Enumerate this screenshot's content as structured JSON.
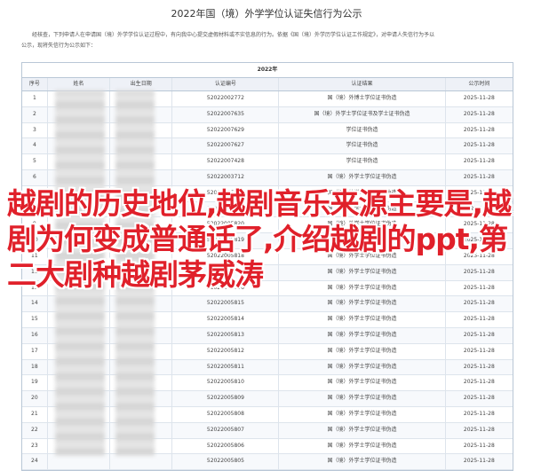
{
  "document": {
    "title": "2022年国（境）外学学位认证失信行为公示",
    "intro_line1": "经核查，下列申请人在申请国（境）外学学位认证过程中，有向我中心提交虚假材料或不实信息的行为。依据《国（境）外学历学位认证工作规定》，对申请人失信行为予以",
    "intro_line2": "公示，现将失信行为公示如下："
  },
  "table": {
    "caption": "2022年",
    "headers": [
      "序号",
      "姓名",
      "出生日期",
      "认证编号",
      "认证结果",
      "公示时间"
    ],
    "rows": [
      [
        "1",
        "",
        "",
        "52022002772",
        "国（境）外博士学位证书伪造",
        "2025-11-28"
      ],
      [
        "2",
        "",
        "",
        "52022007635",
        "国（境）外学士学位证书及学士证书伪造",
        "2025-11-28"
      ],
      [
        "3",
        "",
        "",
        "52022007629",
        "学位证书伪造",
        "2025-11-28"
      ],
      [
        "4",
        "",
        "",
        "52022007627",
        "学位证书伪造",
        "2025-11-28"
      ],
      [
        "5",
        "",
        "",
        "52022007428",
        "学位证书伪造",
        "2025-11-28"
      ],
      [
        "6",
        "",
        "",
        "52022003712",
        "国（境）外学士学位证书伪造",
        "2025-11-28"
      ],
      [
        "7",
        "",
        "",
        "52022005822",
        "国（境）外学士学位证书伪造",
        "2025-11-28"
      ],
      [
        "8",
        "",
        "",
        "52022005821",
        "国（境）外学士学位证书伪造",
        "2025-11-28"
      ],
      [
        "9",
        "",
        "",
        "52022005820",
        "国（境）外学士学位证书伪造",
        "2025-11-28"
      ],
      [
        "10",
        "",
        "",
        "52022005819",
        "国（境）外学士学位证书伪造",
        "2025-11-28"
      ],
      [
        "11",
        "",
        "",
        "52022005818",
        "国（境）外学士学位证书伪造",
        "2025-11-28"
      ],
      [
        "12",
        "",
        "",
        "52022005817",
        "国（境）外学士学位证书伪造",
        "2025-11-28"
      ],
      [
        "13",
        "",
        "",
        "52022005816",
        "国（境）外学士学位证书伪造",
        "2025-11-28"
      ],
      [
        "14",
        "",
        "",
        "52022005815",
        "国（境）外学士学位证书伪造",
        "2025-11-28"
      ],
      [
        "15",
        "",
        "",
        "52022005814",
        "国（境）外学士学位证书伪造",
        "2025-11-28"
      ],
      [
        "16",
        "",
        "",
        "52022005813",
        "国（境）外学士学位证书伪造",
        "2025-11-28"
      ],
      [
        "17",
        "",
        "",
        "52022005812",
        "国（境）外学士学位证书伪造",
        "2025-11-28"
      ],
      [
        "18",
        "",
        "",
        "52022005811",
        "国（境）外学士学位证书伪造",
        "2025-11-28"
      ],
      [
        "19",
        "",
        "",
        "52022005810",
        "国（境）外学士学位证书伪造",
        "2025-11-28"
      ],
      [
        "20",
        "",
        "",
        "52022005809",
        "国（境）外学士学位证书伪造",
        "2025-11-28"
      ],
      [
        "21",
        "",
        "",
        "52022005808",
        "国（境）外学士学位证书伪造",
        "2025-11-28"
      ],
      [
        "22",
        "",
        "",
        "52022005807",
        "国（境）外学士学位证书伪造",
        "2025-11-28"
      ],
      [
        "23",
        "",
        "",
        "52022005806",
        "国（境）外学士学位证书伪造",
        "2025-11-28"
      ],
      [
        "24",
        "",
        "",
        "52022005805",
        "国（境）外学士学位证书伪造",
        "2025-11-28"
      ]
    ]
  },
  "overlay": {
    "text": "越剧的历史地位,越剧音乐来源主要是,越剧为何变成普通话了,介绍越剧的ppt,第二大剧种越剧茅威涛",
    "color": "#e0202a"
  }
}
